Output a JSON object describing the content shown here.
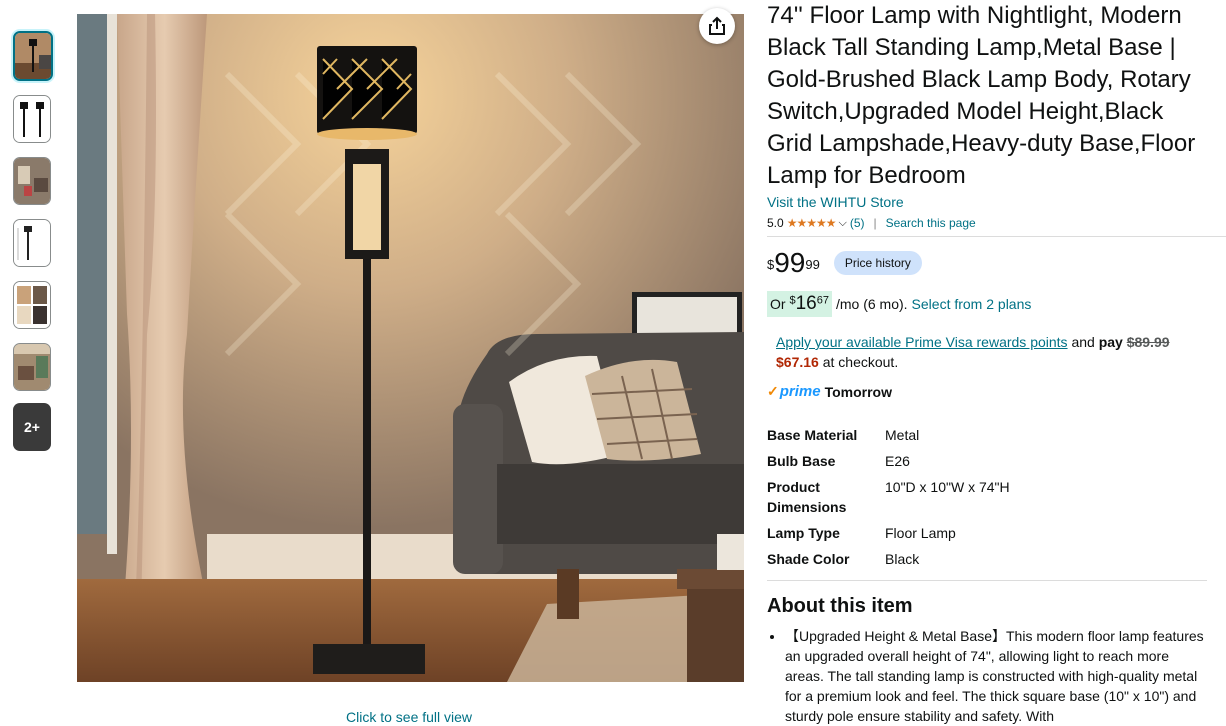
{
  "thumbnails": {
    "more_label": "2+"
  },
  "gallery": {
    "see_full_view": "Click to see full view"
  },
  "product": {
    "title": "74'' Floor Lamp with Nightlight, Modern Black Tall Standing Lamp,Metal Base | Gold-Brushed Black Lamp Body, Rotary Switch,Upgraded Model Height,Black Grid Lampshade,Heavy-duty Base,Floor Lamp for Bedroom",
    "store_link": "Visit the WIHTU Store",
    "rating": "5.0",
    "stars": "★★★★★",
    "review_count": "(5)",
    "separator": "|",
    "search_page": "Search this page"
  },
  "price": {
    "symbol": "$",
    "whole": "99",
    "fraction": "99",
    "history_label": "Price history"
  },
  "monthly": {
    "or": "Or",
    "symbol": "$",
    "whole": "16",
    "fraction": "67",
    "suffix": "/mo (6 mo).",
    "select_plans": "Select from 2 plans"
  },
  "prime_visa": {
    "link": "Apply your available Prime Visa rewards points",
    "and_pay": "and",
    "pay": "pay",
    "old_price": "$89.99",
    "new_price": "$67.16",
    "at_checkout": "at checkout."
  },
  "delivery": {
    "prime": "prime",
    "day": "Tomorrow"
  },
  "specs": [
    {
      "key": "Base Material",
      "value": "Metal"
    },
    {
      "key": "Bulb Base",
      "value": "E26"
    },
    {
      "key": "Product Dimensions",
      "value": "10\"D x 10\"W x 74\"H"
    },
    {
      "key": "Lamp Type",
      "value": "Floor Lamp"
    },
    {
      "key": "Shade Color",
      "value": "Black"
    }
  ],
  "about": {
    "title": "About this item",
    "bullets": [
      "【Upgraded Height & Metal Base】This modern floor lamp features an upgraded overall height of 74\", allowing light to reach more areas. The tall standing lamp is constructed with high-quality metal for a premium look and feel. The thick square base (10\" x 10\") and sturdy pole ensure stability and safety. With"
    ]
  }
}
